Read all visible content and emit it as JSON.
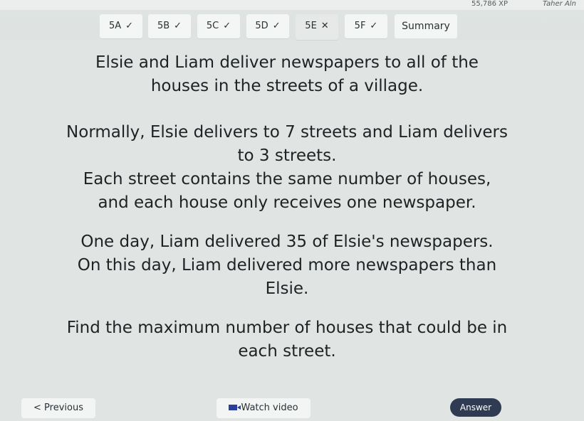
{
  "header": {
    "xp": "55,786 XP",
    "user_name": "Taher Aln"
  },
  "tabs": [
    {
      "label": "5A",
      "status": "✓"
    },
    {
      "label": "5B",
      "status": "✓"
    },
    {
      "label": "5C",
      "status": "✓"
    },
    {
      "label": "5D",
      "status": "✓"
    },
    {
      "label": "5E",
      "status": "✕"
    },
    {
      "label": "5F",
      "status": "✓"
    }
  ],
  "summary_label": "Summary",
  "question": {
    "p1": [
      "Elsie and Liam deliver newspapers to all of the",
      "houses in the streets of a village."
    ],
    "p2": [
      "Normally, Elsie delivers to 7 streets and Liam delivers",
      "to 3 streets."
    ],
    "p3": [
      "Each street contains the same number of houses,",
      "and each house only receives one newspaper."
    ],
    "p4": [
      "One day, Liam delivered 35 of Elsie's newspapers.",
      "On this day, Liam delivered more newspapers than",
      "Elsie."
    ],
    "p5": [
      "Find the maximum number of houses that could be in",
      "each street."
    ]
  },
  "footer": {
    "previous_label": "< Previous",
    "video_label": "Watch video",
    "answer_label": "Answer"
  },
  "colors": {
    "answer_button": "#2e3b52",
    "video_icon": "#2a3e9c"
  }
}
